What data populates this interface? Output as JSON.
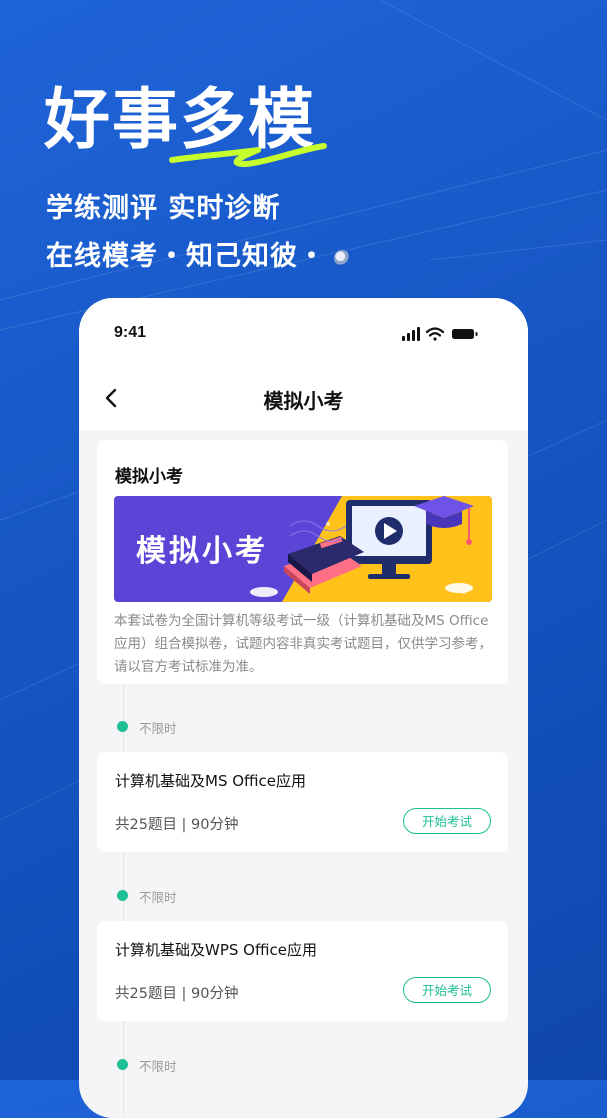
{
  "hero": {
    "title": "好事多模",
    "subtitle1": "学练测评 实时诊断",
    "subtitle2": "在线模考・知己知彼・"
  },
  "status_bar": {
    "time": "9:41",
    "icons": [
      "signal-icon",
      "wifi-icon",
      "battery-icon"
    ]
  },
  "nav": {
    "back_icon": "chevron-left-icon",
    "title": "模拟小考"
  },
  "info_card": {
    "title": "模拟小考",
    "banner_text": "模拟小考",
    "description": "本套试卷为全国计算机等级考试一级（计算机基础及MS Office应用）组合模拟卷，试题内容非真实考试题目，仅供学习参考，请以官方考试标准为准。"
  },
  "exams": [
    {
      "time_label": "不限时",
      "name": "计算机基础及MS Office应用",
      "meta": "共25题目 | 90分钟",
      "button": "开始考试"
    },
    {
      "time_label": "不限时",
      "name": "计算机基础及WPS Office应用",
      "meta": "共25题目 | 90分钟",
      "button": "开始考试"
    },
    {
      "time_label": "不限时"
    }
  ],
  "colors": {
    "background": "#1656c4",
    "accent": "#1fbf95",
    "squiggle": "#c7ff2e",
    "banner_purple": "#5b45d6",
    "banner_yellow": "#ffc21a"
  }
}
